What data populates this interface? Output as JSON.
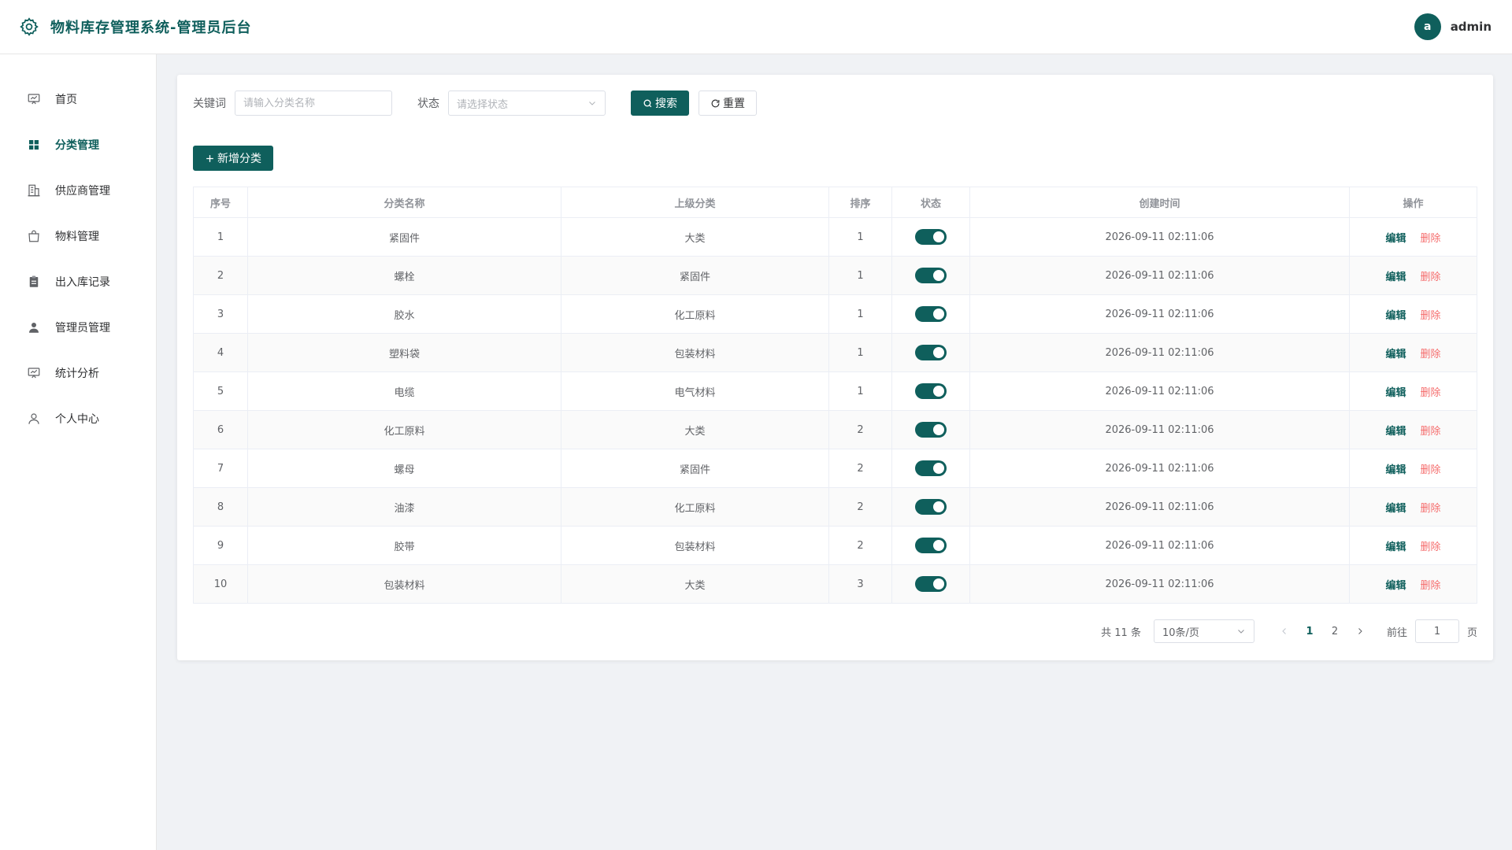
{
  "header": {
    "title": "物料库存管理系统-管理员后台",
    "avatar_letter": "a",
    "username": "admin"
  },
  "sidebar": {
    "items": [
      {
        "label": "首页",
        "icon": "monitor-icon",
        "active": false
      },
      {
        "label": "分类管理",
        "icon": "grid-icon",
        "active": true
      },
      {
        "label": "供应商管理",
        "icon": "building-icon",
        "active": false
      },
      {
        "label": "物料管理",
        "icon": "bag-icon",
        "active": false
      },
      {
        "label": "出入库记录",
        "icon": "clipboard-icon",
        "active": false
      },
      {
        "label": "管理员管理",
        "icon": "user-filled-icon",
        "active": false
      },
      {
        "label": "统计分析",
        "icon": "monitor-icon",
        "active": false
      },
      {
        "label": "个人中心",
        "icon": "user-outline-icon",
        "active": false
      }
    ]
  },
  "search": {
    "keyword_label": "关键词",
    "keyword_placeholder": "请输入分类名称",
    "status_label": "状态",
    "status_placeholder": "请选择状态",
    "search_label": "搜索",
    "reset_label": "重置"
  },
  "toolbar": {
    "add_label": "新增分类"
  },
  "table": {
    "headers": [
      "序号",
      "分类名称",
      "上级分类",
      "排序",
      "状态",
      "创建时间",
      "操作"
    ],
    "edit_label": "编辑",
    "delete_label": "删除",
    "rows": [
      {
        "no": "1",
        "name": "紧固件",
        "parent": "大类",
        "sort": "1",
        "enabled": true,
        "created": "2026-09-11 02:11:06"
      },
      {
        "no": "2",
        "name": "螺栓",
        "parent": "紧固件",
        "sort": "1",
        "enabled": true,
        "created": "2026-09-11 02:11:06"
      },
      {
        "no": "3",
        "name": "胶水",
        "parent": "化工原料",
        "sort": "1",
        "enabled": true,
        "created": "2026-09-11 02:11:06"
      },
      {
        "no": "4",
        "name": "塑料袋",
        "parent": "包装材料",
        "sort": "1",
        "enabled": true,
        "created": "2026-09-11 02:11:06"
      },
      {
        "no": "5",
        "name": "电缆",
        "parent": "电气材料",
        "sort": "1",
        "enabled": true,
        "created": "2026-09-11 02:11:06"
      },
      {
        "no": "6",
        "name": "化工原料",
        "parent": "大类",
        "sort": "2",
        "enabled": true,
        "created": "2026-09-11 02:11:06"
      },
      {
        "no": "7",
        "name": "螺母",
        "parent": "紧固件",
        "sort": "2",
        "enabled": true,
        "created": "2026-09-11 02:11:06"
      },
      {
        "no": "8",
        "name": "油漆",
        "parent": "化工原料",
        "sort": "2",
        "enabled": true,
        "created": "2026-09-11 02:11:06"
      },
      {
        "no": "9",
        "name": "胶带",
        "parent": "包装材料",
        "sort": "2",
        "enabled": true,
        "created": "2026-09-11 02:11:06"
      },
      {
        "no": "10",
        "name": "包装材料",
        "parent": "大类",
        "sort": "3",
        "enabled": true,
        "created": "2026-09-11 02:11:06"
      }
    ]
  },
  "pagination": {
    "total_text": "共 11 条",
    "page_size": "10条/页",
    "pages": [
      "1",
      "2"
    ],
    "current_page": "1",
    "goto_label": "前往",
    "goto_value": "1",
    "goto_suffix": "页"
  },
  "colors": {
    "primary": "#0f5f5c",
    "danger": "#f56c6c"
  }
}
